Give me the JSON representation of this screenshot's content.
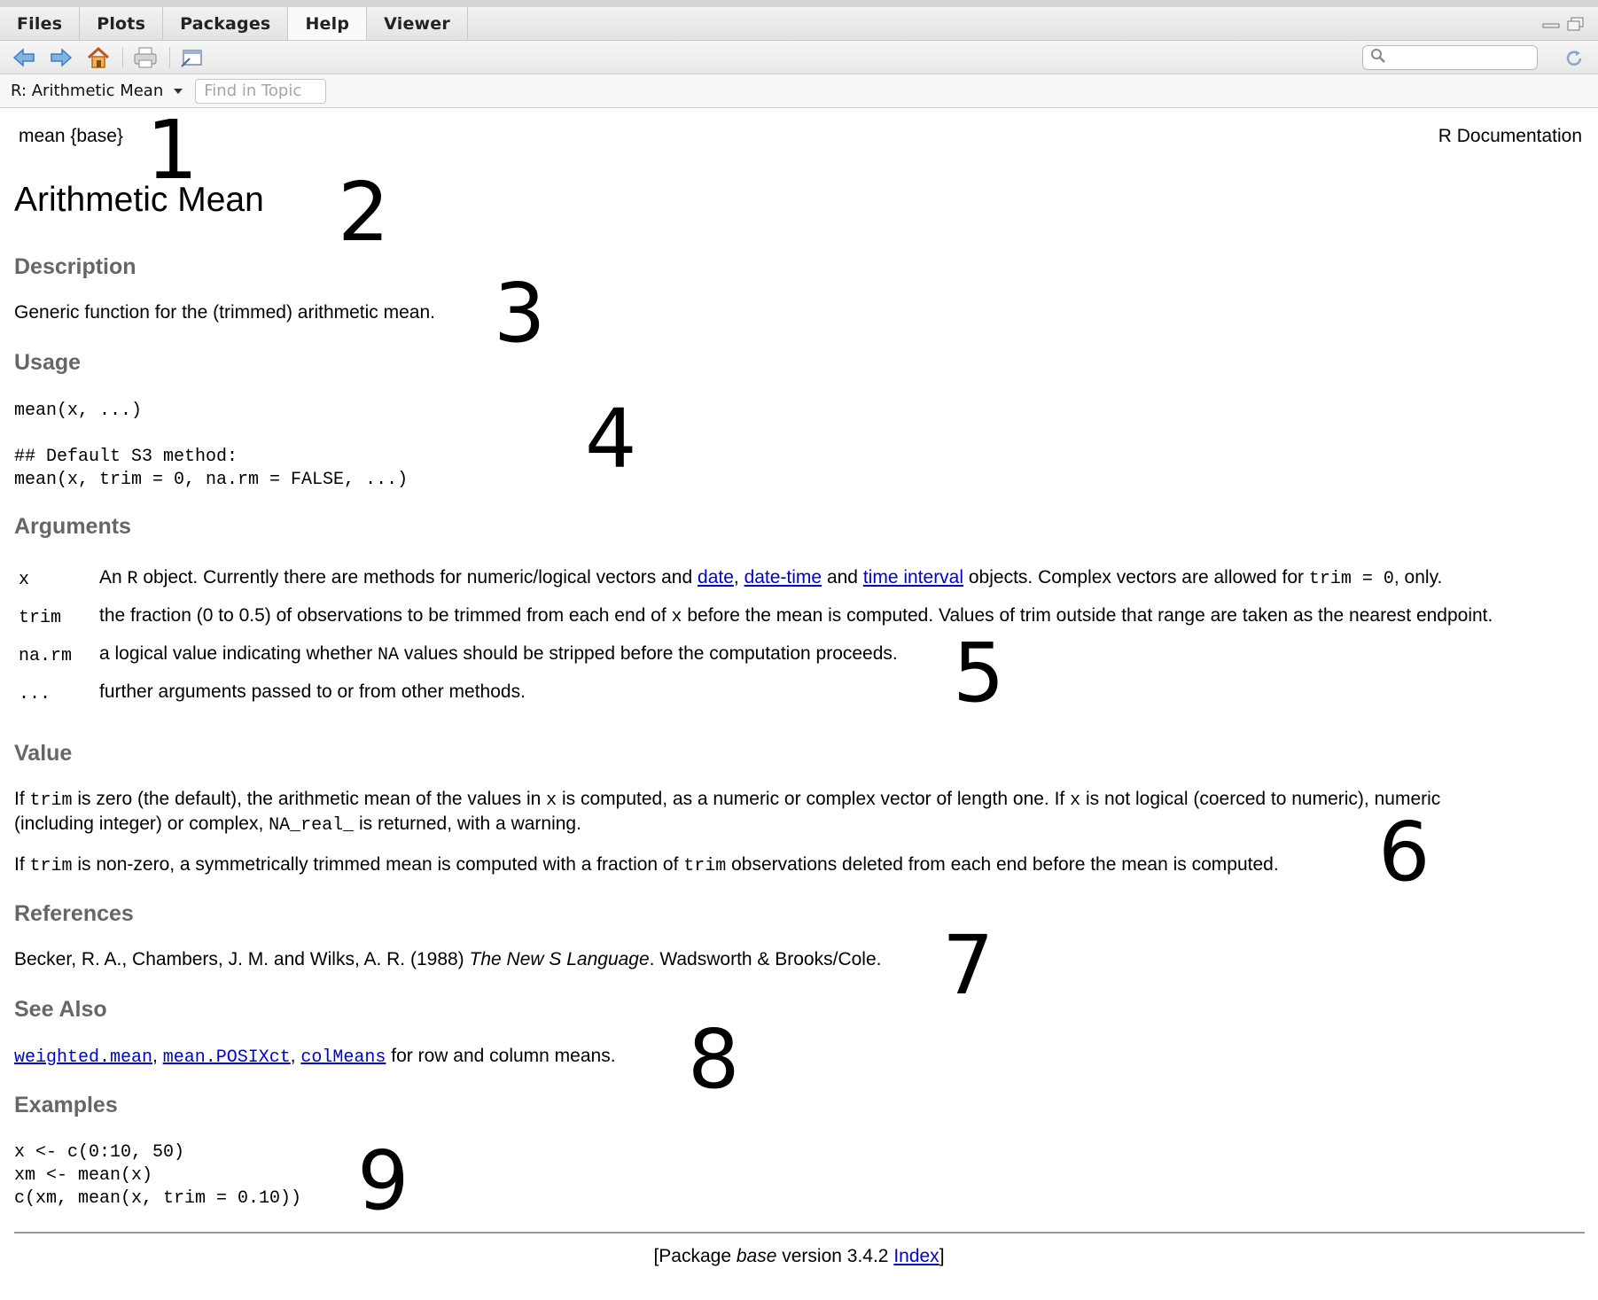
{
  "tabs": [
    "Files",
    "Plots",
    "Packages",
    "Help",
    "Viewer"
  ],
  "active_tab": "Help",
  "toolbar": {
    "icons": [
      "back-arrow-icon",
      "forward-arrow-icon",
      "home-icon",
      "print-icon",
      "open-in-window-icon"
    ],
    "search_placeholder": ""
  },
  "topic_bar": {
    "selected_topic": "R: Arithmetic Mean",
    "find_placeholder": "Find in Topic"
  },
  "doc": {
    "header_left": "mean {base}",
    "header_right": "R Documentation",
    "title": "Arithmetic Mean",
    "sections": {
      "description": "Description",
      "usage": "Usage",
      "arguments": "Arguments",
      "value": "Value",
      "references": "References",
      "see_also": "See Also",
      "examples": "Examples"
    },
    "description_text": "Generic function for the (trimmed) arithmetic mean.",
    "usage_lines": [
      "mean(x, ...)",
      "",
      "## Default S3 method:",
      "mean(x, trim = 0, na.rm = FALSE, ...)"
    ],
    "arguments": [
      {
        "name": "x",
        "parts": [
          "An ",
          "R",
          " object. Currently there are methods for numeric/logical vectors and ",
          "date",
          ", ",
          "date-time",
          " and ",
          "time interval",
          " objects. Complex vectors are allowed for ",
          "trim = 0",
          ", only."
        ]
      },
      {
        "name": "trim",
        "parts": [
          "the fraction (0 to 0.5) of observations to be trimmed from each end of ",
          "x",
          " before the mean is computed. Values of trim outside that range are taken as the nearest endpoint."
        ]
      },
      {
        "name": "na.rm",
        "parts": [
          "a logical value indicating whether ",
          "NA",
          " values should be stripped before the computation proceeds."
        ]
      },
      {
        "name": "...",
        "parts": [
          "further arguments passed to or from other methods."
        ]
      }
    ],
    "value_p1": [
      "If ",
      "trim",
      " is zero (the default), the arithmetic mean of the values in ",
      "x",
      " is computed, as a numeric or complex vector of length one. If ",
      "x",
      " is not logical (coerced to numeric), numeric",
      "(including integer) or complex, ",
      "NA_real_",
      " is returned, with a warning."
    ],
    "value_p2": [
      "If ",
      "trim",
      " is non-zero, a symmetrically trimmed mean is computed with a fraction of ",
      "trim",
      " observations deleted from each end before the mean is computed."
    ],
    "reference": [
      "Becker, R. A., Chambers, J. M. and Wilks, A. R. (1988) ",
      "The New S Language",
      ". Wadsworth & Brooks/Cole."
    ],
    "see_also": [
      "weighted.mean",
      ", ",
      "mean.POSIXct",
      ", ",
      "colMeans",
      " for row and column means."
    ],
    "examples": [
      "x <- c(0:10, 50)",
      "xm <- mean(x)",
      "c(xm, mean(x, trim = 0.10))"
    ],
    "footer": [
      "[Package ",
      "base",
      " version 3.4.2 ",
      "Index",
      "]"
    ]
  },
  "annotation_numbers": [
    "1",
    "2",
    "3",
    "4",
    "5",
    "6",
    "7",
    "8",
    "9"
  ]
}
